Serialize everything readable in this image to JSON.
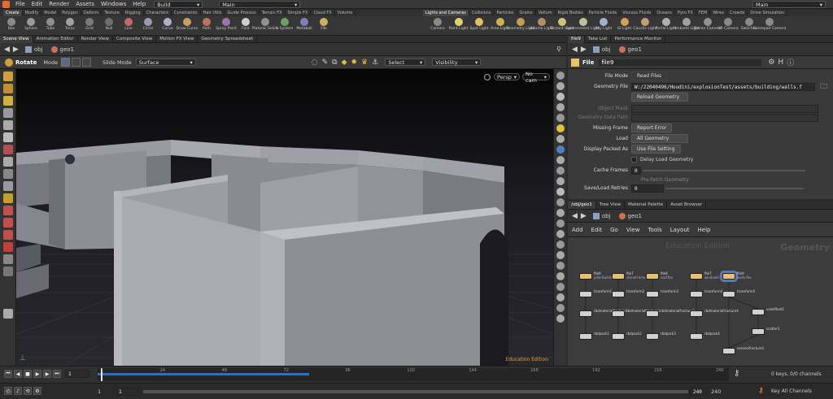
{
  "menubar": {
    "items": [
      "File",
      "Edit",
      "Render",
      "Assets",
      "Windows",
      "Help"
    ],
    "desktop": "Build",
    "main": "Main",
    "right_main": "Main"
  },
  "shelf_tabs_left": [
    "Create",
    "Modify",
    "Model",
    "Polygon",
    "Deform",
    "Texture",
    "Rigging",
    "Characters",
    "Constraints",
    "Hair Utils",
    "Guide Process",
    "Terrain FX",
    "Simple FX",
    "Cloud FX",
    "Volume"
  ],
  "shelf_tabs_right": [
    "Lights and Cameras",
    "Collisions",
    "Particles",
    "Grains",
    "Vellum",
    "Rigid Bodies",
    "Particle Fluids",
    "Viscous Fluids",
    "Oceans",
    "Pyro FX",
    "FEM",
    "Wires",
    "Crowds",
    "Drive Simulation"
  ],
  "tools_left": [
    {
      "label": "Box",
      "color": "#8a8a8a"
    },
    {
      "label": "Sphere",
      "color": "#9a9a9a"
    },
    {
      "label": "Tube",
      "color": "#8f8f8f"
    },
    {
      "label": "Torus",
      "color": "#a0a0a0"
    },
    {
      "label": "Grid",
      "color": "#7a7a7a"
    },
    {
      "label": "Null",
      "color": "#6f6f6f"
    },
    {
      "label": "Line",
      "color": "#c06a6a"
    },
    {
      "label": "Circle",
      "color": "#9a9ab0"
    },
    {
      "label": "Curve",
      "color": "#b0b0c8"
    },
    {
      "label": "Draw Curve",
      "color": "#c8a060"
    },
    {
      "label": "Path",
      "color": "#c07060"
    },
    {
      "label": "Spray Paint",
      "color": "#a070b0"
    },
    {
      "label": "Font",
      "color": "#d0d0d0"
    },
    {
      "label": "Platonic Solids",
      "color": "#909090"
    },
    {
      "label": "L-System",
      "color": "#70a060"
    },
    {
      "label": "Metaball",
      "color": "#8080c0"
    },
    {
      "label": "File",
      "color": "#d0b060"
    }
  ],
  "tools_right": [
    {
      "label": "Camera",
      "color": "#8a8a8a"
    },
    {
      "label": "Point Light",
      "color": "#e0d070"
    },
    {
      "label": "Spot Light",
      "color": "#e0c060"
    },
    {
      "label": "Area Light",
      "color": "#d0b050"
    },
    {
      "label": "Geometry Light",
      "color": "#c0a050"
    },
    {
      "label": "Volume Light",
      "color": "#b09060"
    },
    {
      "label": "Distant Light",
      "color": "#d0c080"
    },
    {
      "label": "Environment Light",
      "color": "#c0c0a0"
    },
    {
      "label": "Sky Light",
      "color": "#a0b0d0"
    },
    {
      "label": "GI Light",
      "color": "#d0a060"
    },
    {
      "label": "Caustic Light",
      "color": "#c0a070"
    },
    {
      "label": "Portal Light",
      "color": "#b0b0b0"
    },
    {
      "label": "Ambient Light",
      "color": "#a0a0a0"
    },
    {
      "label": "Stereo Camera",
      "color": "#909090"
    },
    {
      "label": "VR Camera",
      "color": "#8a8a8a"
    },
    {
      "label": "Switcher",
      "color": "#8a8a8a"
    },
    {
      "label": "Gamepad Camera",
      "color": "#8a8a8a"
    }
  ],
  "pane_tabs": [
    "Scene View",
    "Animation Editor",
    "Render View",
    "Composite View",
    "Motion FX View",
    "Geometry Spreadsheet"
  ],
  "parm_tabs": [
    "file9",
    "Take List",
    "Performance Monitor"
  ],
  "path": {
    "obj": "obj",
    "geo": "geo1"
  },
  "viewport_toolbar": {
    "tool": "Rotate",
    "mode_label": "Mode",
    "slide_mode_label": "Slide Mode",
    "slide_mode_value": "Surface",
    "select_value": "Select",
    "visibility_value": "Visibility"
  },
  "viewport": {
    "persp": "Persp",
    "cam": "No cam",
    "watermark": "Education Edition"
  },
  "parms": {
    "node_type": "File",
    "node_name": "file9",
    "file_mode_label": "File Mode",
    "file_mode_value": "Read Files",
    "geometry_file_label": "Geometry File",
    "geometry_file_value": "W:/22040496/Houdini/explosionTest/assets/building/walls.f",
    "reload_label": "Reload Geometry",
    "object_mask_label": "Object Mask",
    "geometry_data_path_label": "Geometry Data Path",
    "missing_frame_label": "Missing Frame",
    "missing_frame_value": "Report Error",
    "load_label": "Load",
    "load_value": "All Geometry",
    "display_packed_label": "Display Packed As",
    "display_packed_value": "Use File Setting",
    "delay_load_label": "Delay Load Geometry",
    "cache_frames_label": "Cache Frames",
    "cache_frames_value": "0",
    "prefetch_label": "Pre-fetch Geometry",
    "retries_label": "Save/Load Retries",
    "retries_value": "0"
  },
  "net_tabs": [
    "/obj/geo1",
    "Tree View",
    "Material Palette",
    "Asset Browser"
  ],
  "net_menu": [
    "Add",
    "Edit",
    "Go",
    "View",
    "Tools",
    "Layout",
    "Help"
  ],
  "network": {
    "watermark": "Education Edition",
    "context": "Geometry"
  },
  "nodes": [
    {
      "name": "file6",
      "sub": "pillarBuilding.fbx",
      "color": "#e8c070"
    },
    {
      "name": "file7",
      "sub": "stoneFrame.fbx",
      "color": "#e8c070"
    },
    {
      "name": "file8",
      "sub": "roof.fbx",
      "color": "#e8c070"
    },
    {
      "name": "file7",
      "sub": "windowFrame.fbx",
      "color": "#e8c070"
    },
    {
      "name": "file9",
      "sub": "walls.fbx",
      "color": "#e8c070"
    },
    {
      "name": "transform1",
      "sub": "",
      "color": "#d0d0d0"
    },
    {
      "name": "transform2",
      "sub": "",
      "color": "#d0d0d0"
    },
    {
      "name": "transform3",
      "sub": "",
      "color": "#d0d0d0"
    },
    {
      "name": "transform4",
      "sub": "",
      "color": "#d0d0d0"
    },
    {
      "name": "transform5",
      "sub": "",
      "color": "#d0d0d0"
    },
    {
      "name": "rbdmaterialfracture1",
      "sub": "",
      "color": "#d0d0d0"
    },
    {
      "name": "rbdmaterialfracture2",
      "sub": "",
      "color": "#d0d0d0"
    },
    {
      "name": "rbdmaterialfracture3",
      "sub": "",
      "color": "#d0d0d0"
    },
    {
      "name": "rbdmaterialfracture4",
      "sub": "",
      "color": "#d0d0d0"
    },
    {
      "name": "rbdpack1",
      "sub": "",
      "color": "#d0d0d0"
    },
    {
      "name": "rbdpack2",
      "sub": "",
      "color": "#d0d0d0"
    },
    {
      "name": "rbdpack3",
      "sub": "",
      "color": "#d0d0d0"
    },
    {
      "name": "rbdpack4",
      "sub": "",
      "color": "#d0d0d0"
    },
    {
      "name": "voxelfloat1",
      "sub": "",
      "color": "#d0d0d0"
    },
    {
      "name": "scatter1",
      "sub": "",
      "color": "#d0d0d0"
    },
    {
      "name": "voronoifracture1",
      "sub": "",
      "color": "#d0d0d0"
    }
  ],
  "timeline": {
    "frame": "1",
    "ticks": [
      "1",
      "24",
      "48",
      "72",
      "96",
      "120",
      "144",
      "168",
      "192",
      "216",
      "240"
    ],
    "start": "1",
    "start2": "1",
    "end": "240",
    "end2": "240",
    "keys_info": "0 keys, 0/0 channels",
    "key_all": "Key All Channels",
    "playhead_fraction": 0.0
  },
  "colors": {
    "accent": "#e8a030",
    "range": "#2a6ed0"
  }
}
